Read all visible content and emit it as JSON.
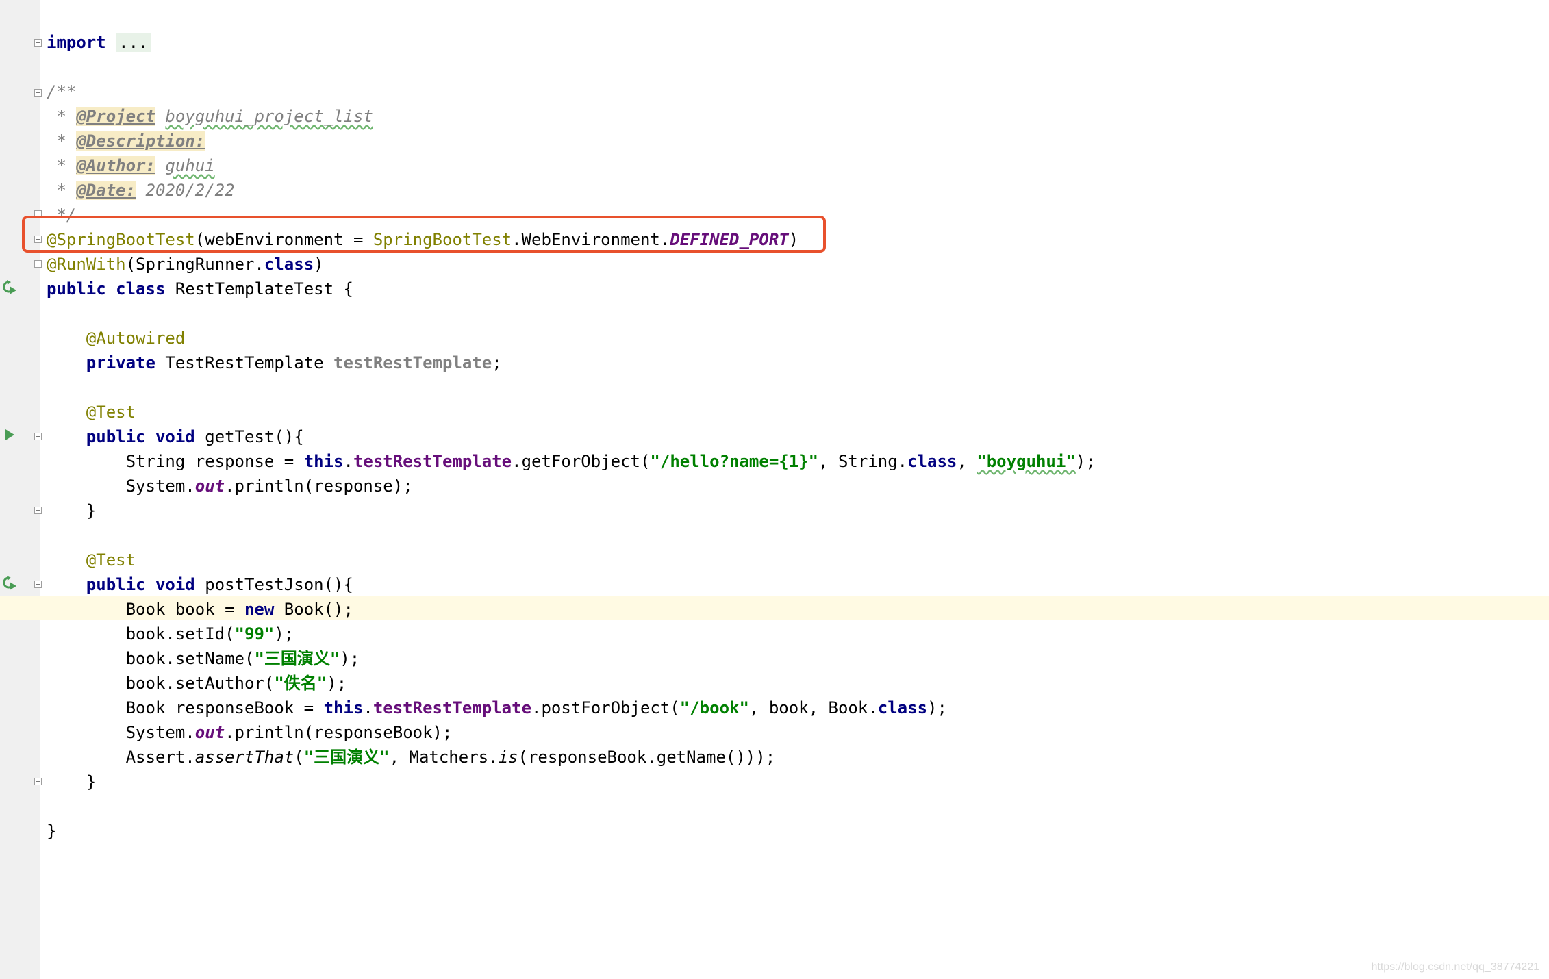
{
  "editor": {
    "lines": [
      {
        "segments": [
          {
            "t": "import",
            "c": "kw"
          },
          {
            "t": " "
          },
          {
            "t": "...",
            "c": "folded"
          }
        ]
      },
      {
        "segments": []
      },
      {
        "segments": [
          {
            "t": "/**",
            "c": "cmt"
          }
        ]
      },
      {
        "segments": [
          {
            "t": " * ",
            "c": "cmt"
          },
          {
            "t": "@Project",
            "c": "tag"
          },
          {
            "t": " ",
            "c": "cmt"
          },
          {
            "t": "boyguhui_project_list",
            "c": "cmt typo"
          }
        ]
      },
      {
        "segments": [
          {
            "t": " * ",
            "c": "cmt"
          },
          {
            "t": "@Description:",
            "c": "tag"
          }
        ]
      },
      {
        "segments": [
          {
            "t": " * ",
            "c": "cmt"
          },
          {
            "t": "@Author:",
            "c": "tag"
          },
          {
            "t": " ",
            "c": "cmt"
          },
          {
            "t": "guhui",
            "c": "cmt typo"
          }
        ]
      },
      {
        "segments": [
          {
            "t": " * ",
            "c": "cmt"
          },
          {
            "t": "@Date:",
            "c": "tag"
          },
          {
            "t": " 2020/2/22",
            "c": "cmt"
          }
        ]
      },
      {
        "segments": [
          {
            "t": " */",
            "c": "cmt"
          }
        ]
      },
      {
        "segments": [
          {
            "t": "@SpringBootTest",
            "c": "ann"
          },
          {
            "t": "(webEnvironment = "
          },
          {
            "t": "SpringBootTest",
            "c": "ann"
          },
          {
            "t": ".WebEnvironment."
          },
          {
            "t": "DEFINED_PORT",
            "c": "static"
          },
          {
            "t": ")"
          }
        ]
      },
      {
        "segments": [
          {
            "t": "@RunWith",
            "c": "ann"
          },
          {
            "t": "(SpringRunner."
          },
          {
            "t": "class",
            "c": "kw"
          },
          {
            "t": ")"
          }
        ]
      },
      {
        "segments": [
          {
            "t": "public",
            "c": "kw"
          },
          {
            "t": " "
          },
          {
            "t": "class",
            "c": "kw"
          },
          {
            "t": " RestTemplateTest {"
          }
        ]
      },
      {
        "segments": []
      },
      {
        "segments": [
          {
            "t": "    "
          },
          {
            "t": "@Autowired",
            "c": "ann"
          }
        ]
      },
      {
        "segments": [
          {
            "t": "    "
          },
          {
            "t": "private",
            "c": "kw"
          },
          {
            "t": " TestRestTemplate "
          },
          {
            "t": "testRestTemplate",
            "c": "field-unused"
          },
          {
            "t": ";"
          }
        ]
      },
      {
        "segments": []
      },
      {
        "segments": [
          {
            "t": "    "
          },
          {
            "t": "@Test",
            "c": "ann"
          }
        ]
      },
      {
        "segments": [
          {
            "t": "    "
          },
          {
            "t": "public",
            "c": "kw"
          },
          {
            "t": " "
          },
          {
            "t": "void",
            "c": "kw"
          },
          {
            "t": " getTest(){"
          }
        ]
      },
      {
        "segments": [
          {
            "t": "        String response = "
          },
          {
            "t": "this",
            "c": "kw"
          },
          {
            "t": "."
          },
          {
            "t": "testRestTemplate",
            "c": "field"
          },
          {
            "t": ".getForObject("
          },
          {
            "t": "\"/hello?name={1}\"",
            "c": "str"
          },
          {
            "t": ", String."
          },
          {
            "t": "class",
            "c": "kw"
          },
          {
            "t": ", "
          },
          {
            "t": "\"boyguhui\"",
            "c": "str typo"
          },
          {
            "t": ");"
          }
        ]
      },
      {
        "segments": [
          {
            "t": "        System."
          },
          {
            "t": "out",
            "c": "static"
          },
          {
            "t": ".println(response);"
          }
        ]
      },
      {
        "segments": [
          {
            "t": "    }"
          }
        ]
      },
      {
        "segments": []
      },
      {
        "segments": [
          {
            "t": "    "
          },
          {
            "t": "@Test",
            "c": "ann"
          }
        ]
      },
      {
        "segments": [
          {
            "t": "    "
          },
          {
            "t": "public",
            "c": "kw"
          },
          {
            "t": " "
          },
          {
            "t": "void",
            "c": "kw"
          },
          {
            "t": " postTestJson(){"
          }
        ]
      },
      {
        "segments": [
          {
            "t": "        Book book = "
          },
          {
            "t": "new",
            "c": "kw"
          },
          {
            "t": " Book();"
          }
        ]
      },
      {
        "segments": [
          {
            "t": "        book.setId("
          },
          {
            "t": "\"99\"",
            "c": "str"
          },
          {
            "t": ");"
          }
        ]
      },
      {
        "segments": [
          {
            "t": "        book.setName("
          },
          {
            "t": "\"三国演义\"",
            "c": "str"
          },
          {
            "t": ");"
          }
        ]
      },
      {
        "segments": [
          {
            "t": "        book.setAuthor("
          },
          {
            "t": "\"佚名\"",
            "c": "str"
          },
          {
            "t": ");"
          }
        ]
      },
      {
        "segments": [
          {
            "t": "        Book responseBook = "
          },
          {
            "t": "this",
            "c": "kw"
          },
          {
            "t": "."
          },
          {
            "t": "testRestTemplate",
            "c": "field"
          },
          {
            "t": ".postForObject("
          },
          {
            "t": "\"/book\"",
            "c": "str"
          },
          {
            "t": ", book, Book."
          },
          {
            "t": "class",
            "c": "kw"
          },
          {
            "t": ");"
          }
        ]
      },
      {
        "segments": [
          {
            "t": "        System."
          },
          {
            "t": "out",
            "c": "static"
          },
          {
            "t": ".println(responseBook);"
          }
        ]
      },
      {
        "segments": [
          {
            "t": "        Assert."
          },
          {
            "t": "assertThat",
            "c": "italic-call"
          },
          {
            "t": "("
          },
          {
            "t": "\"三国演义\"",
            "c": "str"
          },
          {
            "t": ", Matchers."
          },
          {
            "t": "is",
            "c": "italic-call"
          },
          {
            "t": "(responseBook.getName()));"
          }
        ]
      },
      {
        "segments": [
          {
            "t": "    }"
          }
        ]
      },
      {
        "segments": []
      },
      {
        "segments": [
          {
            "t": "}"
          }
        ]
      }
    ]
  },
  "watermark": "https://blog.csdn.net/qq_38774221",
  "colors": {
    "keyword": "#000080",
    "annotation": "#808000",
    "string": "#008000",
    "field": "#660e7a",
    "comment": "#808080",
    "highlight_border": "#e8512d",
    "caret_row": "#fffae3"
  }
}
